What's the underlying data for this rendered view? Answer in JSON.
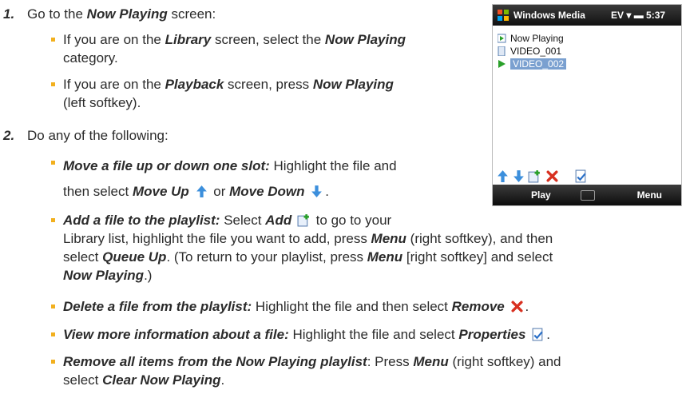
{
  "steps": [
    {
      "num": "1.",
      "text": "Go to the ",
      "em": "Now Playing",
      "tail": " screen:"
    },
    {
      "num": "2.",
      "text": "Do any of the following:"
    }
  ],
  "bullets": {
    "b1": {
      "a": "If you are on the ",
      "b": "Library",
      "c": " screen, select the ",
      "d": "Now Playing",
      "e": "category."
    },
    "b2": {
      "a": "If you are on the ",
      "b": "Playback",
      "c": " screen, press ",
      "d": "Now Playing",
      "e": "(left softkey)."
    },
    "b3": {
      "lead": "Move a file up or down one slot:",
      "a": " Highlight the file and",
      "b": "then select ",
      "c": "Move Up",
      "d": " or ",
      "e": "Move Down",
      "f": "."
    },
    "b4": {
      "lead": "Add a file to the playlist:",
      "a": " Select ",
      "b": "Add",
      "c": " to go to your",
      "l2a": "Library list, highlight the file you want to add, press ",
      "l2b": "Menu",
      "l2c": " (right softkey), and then",
      "l3a": "select ",
      "l3b": "Queue Up",
      "l3c": ". (To return to your playlist, press ",
      "l3d": "Menu",
      "l3e": " [right softkey] and select",
      "l4a": "Now Playing",
      "l4b": ".)"
    },
    "b5": {
      "lead": "Delete a file from the playlist:",
      "a": " Highlight the file and then select ",
      "b": "Remove",
      "c": "."
    },
    "b6": {
      "lead": "View more information about a file:",
      "a": " Highlight the file and select ",
      "b": "Properties",
      "c": "."
    },
    "b7": {
      "lead": "Remove all items from the Now Playing playlist",
      "a": ": Press ",
      "b": "Menu",
      "c": " (right softkey) and",
      "l2a": "select ",
      "l2b": "Clear Now Playing",
      "l2c": "."
    }
  },
  "phone": {
    "title": "Windows Media",
    "status": "EV ▾ ▬ 5:37",
    "list": [
      "Now Playing",
      "VIDEO_001",
      "VIDEO_002"
    ],
    "left_softkey": "Play",
    "right_softkey": "Menu"
  },
  "colors": {
    "bullet": "#f2b01e",
    "arrow": "#3c8fdc",
    "remove": "#d83020"
  }
}
